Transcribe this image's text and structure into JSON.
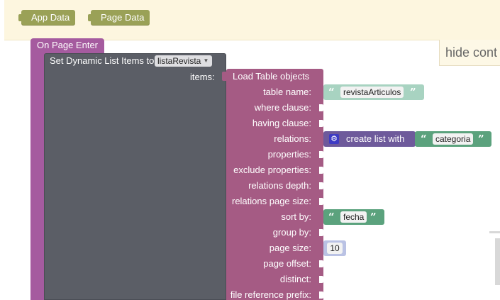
{
  "toolbar": {
    "app_data_label": "App Data",
    "page_data_label": "Page Data"
  },
  "panel": {
    "hide_label": "hide cont"
  },
  "event_block": {
    "label": "On Page Enter"
  },
  "set_block": {
    "label": "Set Dynamic List Items to",
    "selected_list": "listaRevista",
    "items_label": "items:"
  },
  "load_block": {
    "label": "Load Table objects",
    "params": [
      "table name:",
      "where clause:",
      "having clause:",
      "relations:",
      "properties:",
      "exclude properties:",
      "relations depth:",
      "relations page size:",
      "sort by:",
      "group by:",
      "page size:",
      "page offset:",
      "distinct:",
      "file reference prefix:"
    ]
  },
  "values": {
    "table_name": "revistaArticulos",
    "relations_list_label": "create list with",
    "relations_item": "categoria",
    "sort_by": "fecha",
    "page_size": "10"
  },
  "quotes": {
    "open": "“",
    "close": "”"
  },
  "icons": {
    "gear": "gear-icon",
    "trash": "trash-icon"
  },
  "colors": {
    "event_block": "#a55b9f",
    "set_block": "#5b5e66",
    "load_block": "#a55b84",
    "text_block": "#5ba27d",
    "text_block_faded": "#a8d3c1",
    "list_block": "#6e5a9b",
    "number_block": "#bac2e4",
    "variable_button": "#9aa157"
  }
}
